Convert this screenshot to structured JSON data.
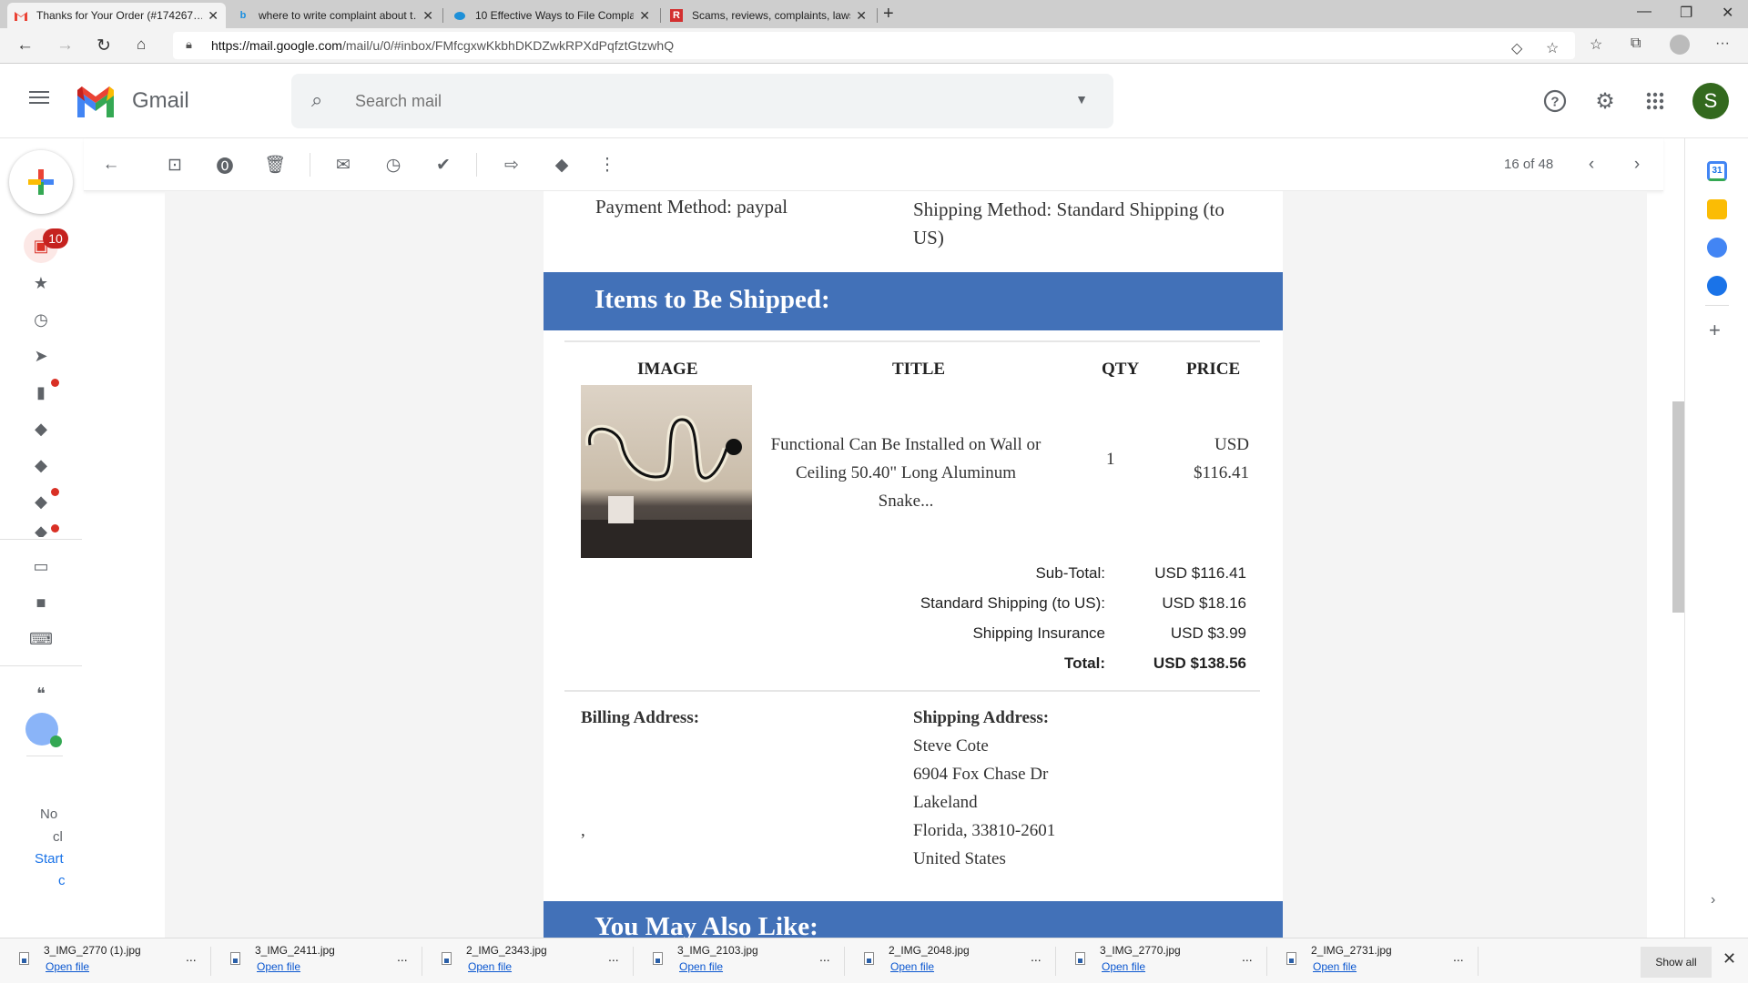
{
  "browser": {
    "tabs": [
      {
        "title": "Thanks for Your Order (#174267…",
        "icon": "gmail-icon",
        "active": true
      },
      {
        "title": "where to write complaint about t…",
        "icon": "bing-icon",
        "active": false
      },
      {
        "title": "10 Effective Ways to File Compla…",
        "icon": "blue-blob-icon",
        "active": false
      },
      {
        "title": "Scams, reviews, complaints, laws…",
        "icon": "ripoff-report-icon",
        "active": false
      }
    ],
    "new_tab": "+",
    "url_host": "https://mail.google.com",
    "url_path": "/mail/u/0/#inbox/FMfcgxwKkbhDKDZwkRPXdPqfztGtzwhQ"
  },
  "gmail": {
    "app_name": "Gmail",
    "search_placeholder": "Search mail",
    "avatar_initial": "S",
    "accent_color": "#4271b8",
    "inbox_badge": "10",
    "pagination": "16 of 48",
    "chat_text": {
      "line1": "No",
      "line2": "cl",
      "link1": "Start",
      "link2": "c"
    }
  },
  "email": {
    "payment_method": "Payment Method: paypal",
    "shipping_method": "Shipping Method: Standard Shipping (to US)",
    "items_heading": "Items to Be Shipped:",
    "columns": {
      "image": "IMAGE",
      "title": "TITLE",
      "qty": "QTY",
      "price": "PRICE"
    },
    "items": [
      {
        "title": "Functional Can Be Installed on Wall or Ceiling 50.40\" Long Aluminum Snake...",
        "qty": "1",
        "price_currency": "USD",
        "price_amount": "$116.41"
      }
    ],
    "summary": [
      {
        "label": "Sub-Total:",
        "value": "USD $116.41",
        "bold": false
      },
      {
        "label": "Standard Shipping (to US):",
        "value": "USD $18.16",
        "bold": false
      },
      {
        "label": "Shipping Insurance",
        "value": "USD $3.99",
        "bold": false
      },
      {
        "label": "Total:",
        "value": "USD $138.56",
        "bold": true
      }
    ],
    "billing_heading": "Billing Address:",
    "billing_lines": [
      ","
    ],
    "shipping_heading": "Shipping Address:",
    "shipping_lines": [
      "Steve Cote",
      "6904 Fox Chase Dr",
      "Lakeland",
      "Florida, 33810-2601",
      "United States"
    ],
    "also_like_heading": "You May Also Like:"
  },
  "downloads": {
    "items": [
      {
        "name": "3_IMG_2770 (1).jpg",
        "action": "Open file"
      },
      {
        "name": "3_IMG_2411.jpg",
        "action": "Open file"
      },
      {
        "name": "2_IMG_2343.jpg",
        "action": "Open file"
      },
      {
        "name": "3_IMG_2103.jpg",
        "action": "Open file"
      },
      {
        "name": "2_IMG_2048.jpg",
        "action": "Open file"
      },
      {
        "name": "3_IMG_2770.jpg",
        "action": "Open file"
      },
      {
        "name": "2_IMG_2731.jpg",
        "action": "Open file"
      }
    ],
    "more": "...",
    "show_all": "Show all"
  }
}
